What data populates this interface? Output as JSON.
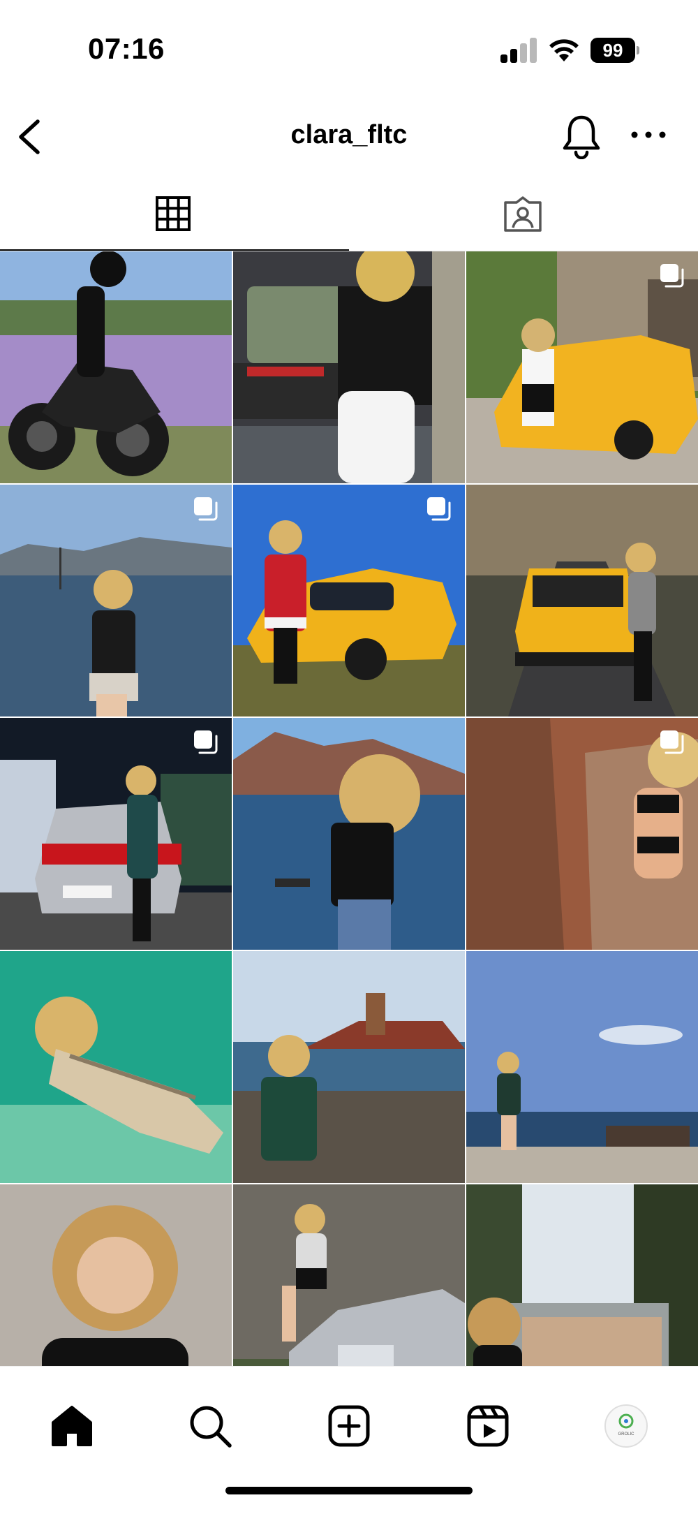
{
  "status_bar": {
    "time": "07:16",
    "battery_level": "99",
    "signal_bars": 2,
    "wifi": true
  },
  "header": {
    "username": "clara_fltc",
    "back_icon": "chevron-left-icon",
    "bell_icon": "bell-icon",
    "more_icon": "more-horizontal-icon"
  },
  "tabs": [
    {
      "icon": "grid-icon",
      "active": true
    },
    {
      "icon": "tagged-person-icon",
      "active": false
    }
  ],
  "grid": {
    "posts": [
      {
        "subject": "motorcycle in lavender field",
        "multi": false
      },
      {
        "subject": "woman sitting in car trunk",
        "multi": false
      },
      {
        "subject": "woman with yellow car by stone building",
        "multi": true
      },
      {
        "subject": "woman by lake",
        "multi": true
      },
      {
        "subject": "woman in red coat with yellow car",
        "multi": true
      },
      {
        "subject": "yellow car on forest road",
        "multi": false
      },
      {
        "subject": "woman with silver car at night",
        "multi": true
      },
      {
        "subject": "woman by the sea",
        "multi": false
      },
      {
        "subject": "woman on rocky stairs",
        "multi": true
      },
      {
        "subject": "swimming underwater",
        "multi": false
      },
      {
        "subject": "woman sitting by tower on red rock",
        "multi": false
      },
      {
        "subject": "woman on shore",
        "multi": false
      },
      {
        "subject": "portrait",
        "multi": false
      },
      {
        "subject": "woman on silver car",
        "multi": false
      },
      {
        "subject": "view over city",
        "multi": false
      }
    ],
    "multi_badge_icon": "multiple-photos-icon"
  },
  "bottom_nav": {
    "items": [
      {
        "icon": "home-icon",
        "active": true
      },
      {
        "icon": "search-icon",
        "active": false
      },
      {
        "icon": "create-post-icon",
        "active": false
      },
      {
        "icon": "reels-icon",
        "active": false
      },
      {
        "icon": "profile-avatar",
        "active": false
      }
    ],
    "avatar_text": "GROLIC"
  },
  "colors": {
    "background": "#ffffff",
    "text": "#000000",
    "divider": "#e6e6e6"
  }
}
